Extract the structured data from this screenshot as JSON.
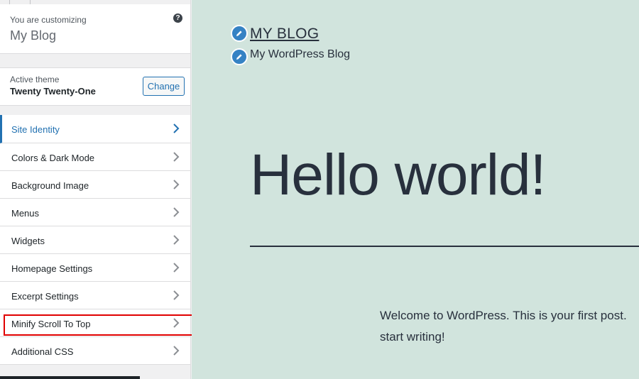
{
  "customizer": {
    "customizing_label": "You are customizing",
    "site_name": "My Blog",
    "help_glyph": "?"
  },
  "theme": {
    "label": "Active theme",
    "name": "Twenty Twenty-One",
    "change_label": "Change"
  },
  "menu": {
    "items": [
      {
        "label": "Site Identity",
        "active": true
      },
      {
        "label": "Colors & Dark Mode"
      },
      {
        "label": "Background Image"
      },
      {
        "label": "Menus"
      },
      {
        "label": "Widgets"
      },
      {
        "label": "Homepage Settings"
      },
      {
        "label": "Excerpt Settings"
      },
      {
        "label": "Minify Scroll To Top",
        "highlighted": true
      },
      {
        "label": "Additional CSS"
      }
    ]
  },
  "preview": {
    "site_title": "MY BLOG",
    "tagline": "My WordPress Blog",
    "post_title": "Hello world!",
    "content_line1": "Welcome to WordPress. This is your first post.",
    "content_line2": "start writing!",
    "background_color": "#d1e4dd",
    "edit_icon_color": "#3582c4"
  },
  "colors": {
    "accent": "#2271b1",
    "highlight_border": "#e00000"
  }
}
